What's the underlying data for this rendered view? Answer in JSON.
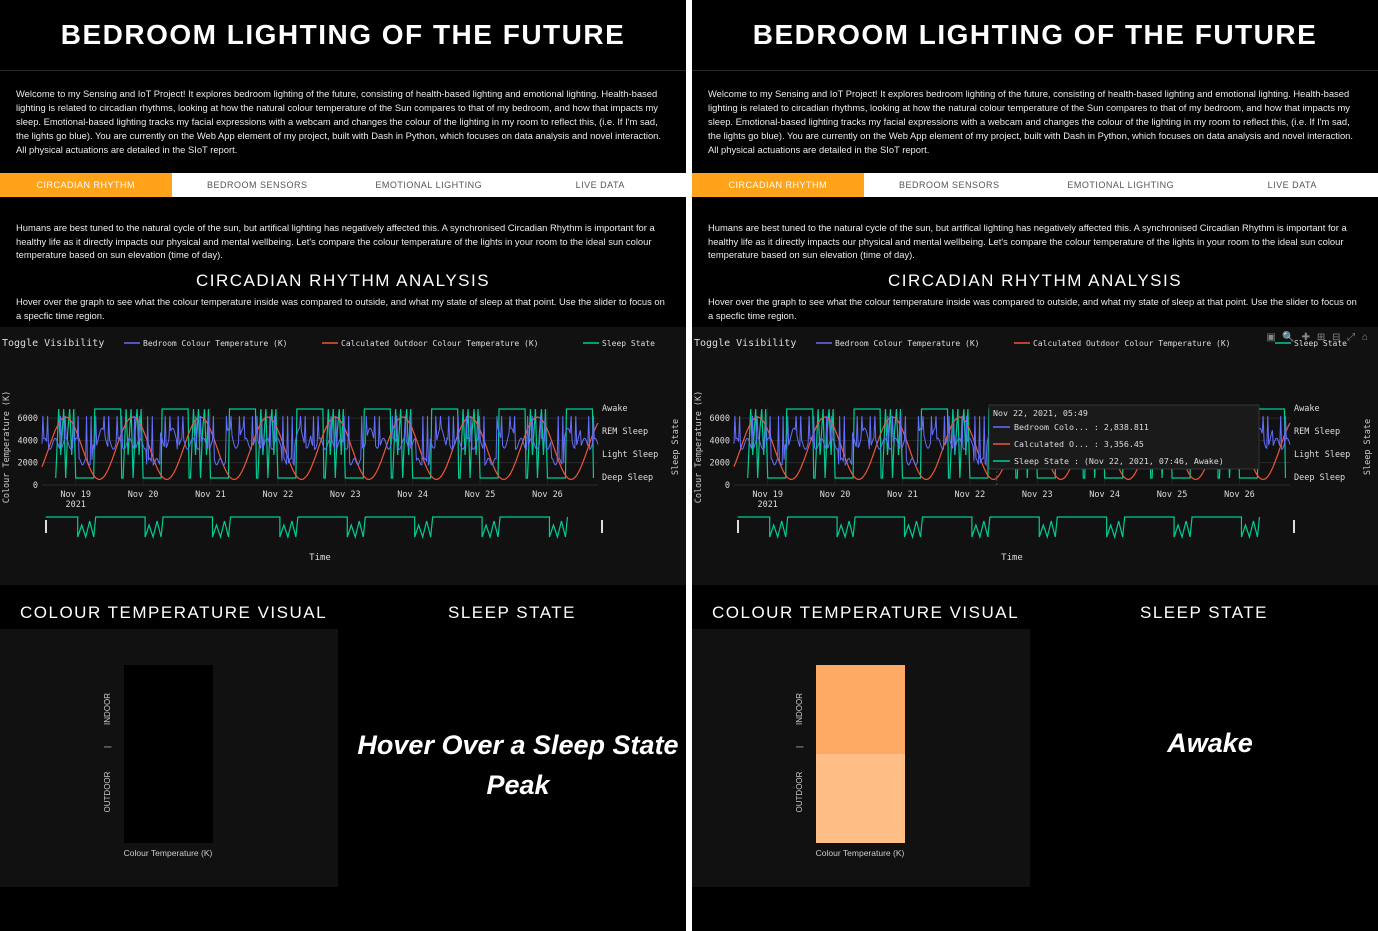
{
  "app": {
    "title": "BEDROOM LIGHTING OF THE FUTURE",
    "intro": "Welcome to my Sensing and IoT Project! It explores bedroom lighting of the future, consisting of health-based lighting and emotional lighting. Health-based lighting is related to circadian rhythms, looking at how the natural colour temperature of the Sun compares to that of my bedroom, and how that impacts my sleep. Emotional-based lighting tracks my facial expressions with a webcam and changes the colour of the lighting in my room to reflect this, (i.e. If I'm sad, the lights go blue). You are currently on the Web App element of my project, built with Dash in Python, which focuses on data analysis and novel interaction. All physical actuations are detailed in the SIoT report.",
    "tabs": [
      "CIRCADIAN RHYTHM",
      "BEDROOM SENSORS",
      "EMOTIONAL LIGHTING",
      "LIVE DATA"
    ],
    "active_tab": "CIRCADIAN RHYTHM",
    "circadian_intro": "Humans are best tuned to the natural cycle of the sun, but artifical lighting has negatively affected this. A synchronised Circadian Rhythm is important for a healthy life as it directly impacts our physical and mental wellbeing. Let's compare the colour temperature of the lights in your room to the ideal sun colour temperature based on sun elevation (time of day).",
    "analysis_title": "CIRCADIAN RHYTHM ANALYSIS",
    "analysis_hint": "Hover over the graph to see what the colour temperature inside was compared to outside, and what my state of sleep at that point. Use the slider to focus on a specfic time region.",
    "legend_title": "Toggle Visibility",
    "legend": [
      "Bedroom Colour Temperature (K)",
      "Calculated Outdoor Colour Temperature (K)",
      "Sleep State"
    ],
    "y_label": "Colour Temperature (K)",
    "y2_label": "Sleep State",
    "x_label": "Time",
    "x_ticks": [
      "Nov 19",
      "Nov 20",
      "Nov 21",
      "Nov 22",
      "Nov 23",
      "Nov 24",
      "Nov 25",
      "Nov 26"
    ],
    "x_year": "2021",
    "y_ticks": [
      "6000",
      "4000",
      "2000",
      "0"
    ],
    "y2_ticks": [
      "Awake",
      "REM Sleep",
      "Light Sleep",
      "Deep Sleep"
    ],
    "colour_visual_title": "COLOUR TEMPERATURE VISUAL",
    "sleep_state_title": "SLEEP STATE",
    "vis_x_label": "Colour Temperature (K)",
    "vis_indoor": "INDOOR",
    "vis_outdoor": "OUTDOOR",
    "vis_separator": "|"
  },
  "left_panel": {
    "sleep_state_text": "Hover Over a Sleep State Peak",
    "indoor_color": "#000000",
    "outdoor_color": "#000000"
  },
  "right_panel": {
    "sleep_state_text": "Awake",
    "indoor_color": "#fdaa64",
    "outdoor_color": "#ffbe86",
    "tooltip": {
      "header": "Nov 22, 2021, 05:49",
      "bedroom": "Bedroom Colo... : 2,838.811",
      "outdoor": "Calculated O... : 3,356.45",
      "sleep": "Sleep State : (Nov 22, 2021, 07:46, Awake)"
    }
  },
  "colors": {
    "accent": "#ffa31a",
    "bedroom_series": "#636efa",
    "outdoor_series": "#ef553b",
    "sleep_series": "#00cc96"
  },
  "chart_data": {
    "type": "line",
    "title": "",
    "xlabel": "Time",
    "ylabel": "Colour Temperature (K)",
    "y2label": "Sleep State",
    "x_range": [
      "2021-11-18T12:00",
      "2021-11-26T18:00"
    ],
    "ylim": [
      0,
      7000
    ],
    "series": [
      {
        "name": "Bedroom Colour Temperature (K)",
        "x_days": [
          0,
          0.3,
          0.6,
          0.9,
          1.2,
          1.5,
          1.8,
          2.1,
          2.4,
          2.7,
          3.0,
          3.3,
          3.6,
          3.9,
          4.2,
          4.5,
          4.8,
          5.1,
          5.4,
          5.7,
          6.0,
          6.3,
          6.6,
          6.9,
          7.2,
          7.5,
          7.8,
          8.1
        ],
        "values": [
          3800,
          4000,
          2000,
          4500,
          3800,
          4100,
          2200,
          4300,
          3900,
          4200,
          2100,
          4400,
          3500,
          2840,
          2400,
          3300,
          3200,
          3300,
          2300,
          3600,
          3500,
          3700,
          2000,
          3400,
          3600,
          3800,
          4200,
          4300
        ]
      },
      {
        "name": "Calculated Outdoor Colour Temperature (K)",
        "x_days": [
          0,
          0.25,
          0.5,
          0.75,
          1.0,
          1.25,
          1.5,
          1.75,
          2.0,
          2.25,
          2.5,
          2.75,
          3.0,
          3.25,
          3.5,
          3.75,
          4.0,
          4.25,
          4.5,
          4.75,
          5.0,
          5.25,
          5.5,
          5.75,
          6.0,
          6.25,
          6.5,
          6.75,
          7.0,
          7.25,
          7.5,
          7.75,
          8.0
        ],
        "values": [
          5000,
          2200,
          1000,
          3200,
          6000,
          2200,
          800,
          3300,
          6000,
          2300,
          900,
          3300,
          6000,
          3356,
          900,
          3200,
          5900,
          2200,
          800,
          3300,
          6000,
          2200,
          900,
          3300,
          6000,
          2300,
          800,
          3300,
          6000,
          2200,
          900,
          3300,
          6000
        ]
      },
      {
        "name": "Sleep State",
        "categories": [
          "Awake",
          "REM Sleep",
          "Light Sleep",
          "Deep Sleep"
        ],
        "sample": [
          "Awake",
          "Light Sleep",
          "Awake",
          "Deep Sleep",
          "Awake",
          "REM Sleep",
          "Awake",
          "Deep Sleep"
        ]
      }
    ],
    "grid": true,
    "legend_placement": "top"
  }
}
